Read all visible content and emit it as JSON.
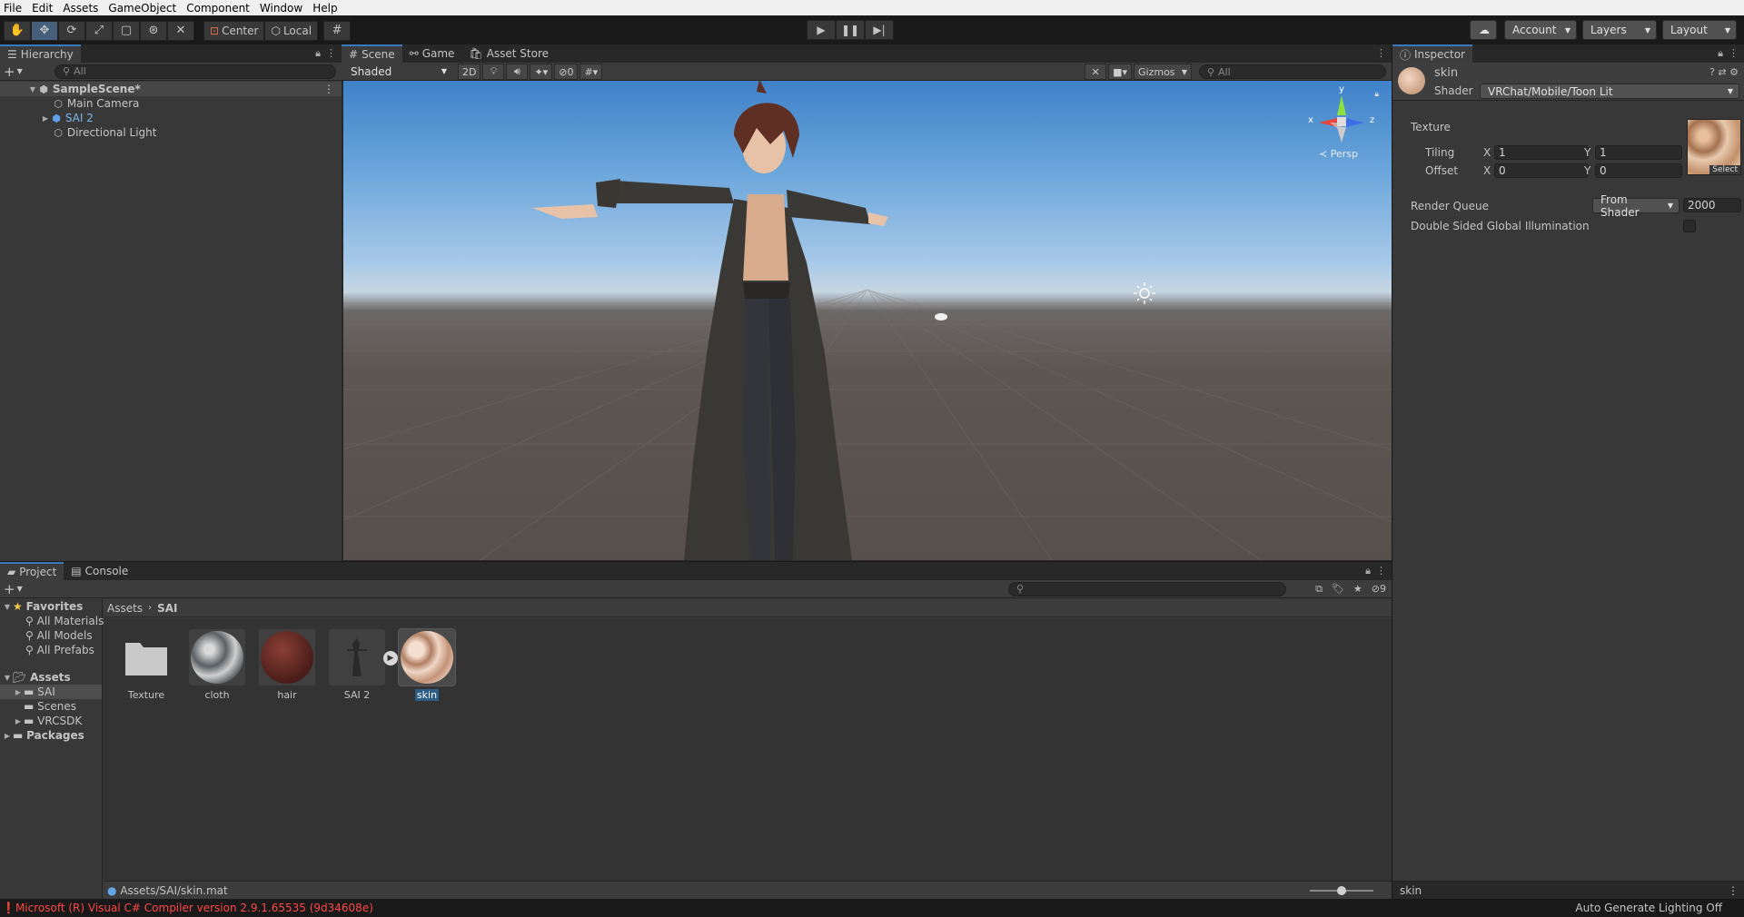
{
  "menu": [
    "File",
    "Edit",
    "Assets",
    "GameObject",
    "Component",
    "Window",
    "Help"
  ],
  "toolbar": {
    "pivot_label": "Center",
    "space_label": "Local",
    "account_label": "Account",
    "layers_label": "Layers",
    "layout_label": "Layout"
  },
  "hierarchy": {
    "tab": "Hierarchy",
    "search_placeholder": "All",
    "scene": "SampleScene*",
    "items": [
      "Main Camera",
      "SAI 2",
      "Directional Light"
    ]
  },
  "scene_view": {
    "tabs": [
      "Scene",
      "Game",
      "Asset Store"
    ],
    "shading_mode": "Shaded",
    "mode_2d": "2D",
    "hidden_count": "0",
    "gizmos_label": "Gizmos",
    "search_placeholder": "All",
    "gizmo_axes": {
      "x": "x",
      "y": "y",
      "z": "z"
    },
    "projection": "Persp"
  },
  "inspector": {
    "tab": "Inspector",
    "material_name": "skin",
    "shader_label": "Shader",
    "shader_value": "VRChat/Mobile/Toon Lit",
    "texture_label": "Texture",
    "select_label": "Select",
    "tiling_label": "Tiling",
    "offset_label": "Offset",
    "tiling_x": "1",
    "tiling_y": "1",
    "offset_x": "0",
    "offset_y": "0",
    "axis_x": "X",
    "axis_y": "Y",
    "render_queue_label": "Render Queue",
    "render_queue_mode": "From Shader",
    "render_queue_value": "2000",
    "dsgi_label": "Double Sided Global Illumination",
    "footer_name": "skin"
  },
  "project": {
    "tabs": [
      "Project",
      "Console"
    ],
    "hidden_count": "9",
    "favorites_label": "Favorites",
    "favorites": [
      "All Materials",
      "All Models",
      "All Prefabs"
    ],
    "assets_label": "Assets",
    "asset_folders": [
      "SAI",
      "Scenes",
      "VRCSDK"
    ],
    "packages_label": "Packages",
    "breadcrumb": [
      "Assets",
      "SAI"
    ],
    "items": [
      "Texture",
      "cloth",
      "hair",
      "SAI 2",
      "skin"
    ],
    "selected_path": "Assets/SAI/skin.mat"
  },
  "status": {
    "error": "Microsoft (R) Visual C# Compiler version 2.9.1.65535 (9d34608e)",
    "lighting": "Auto Generate Lighting Off"
  },
  "colors": {
    "selection": "#2c5d87",
    "tab_accent": "#3a79bb",
    "error": "#ff4747"
  }
}
